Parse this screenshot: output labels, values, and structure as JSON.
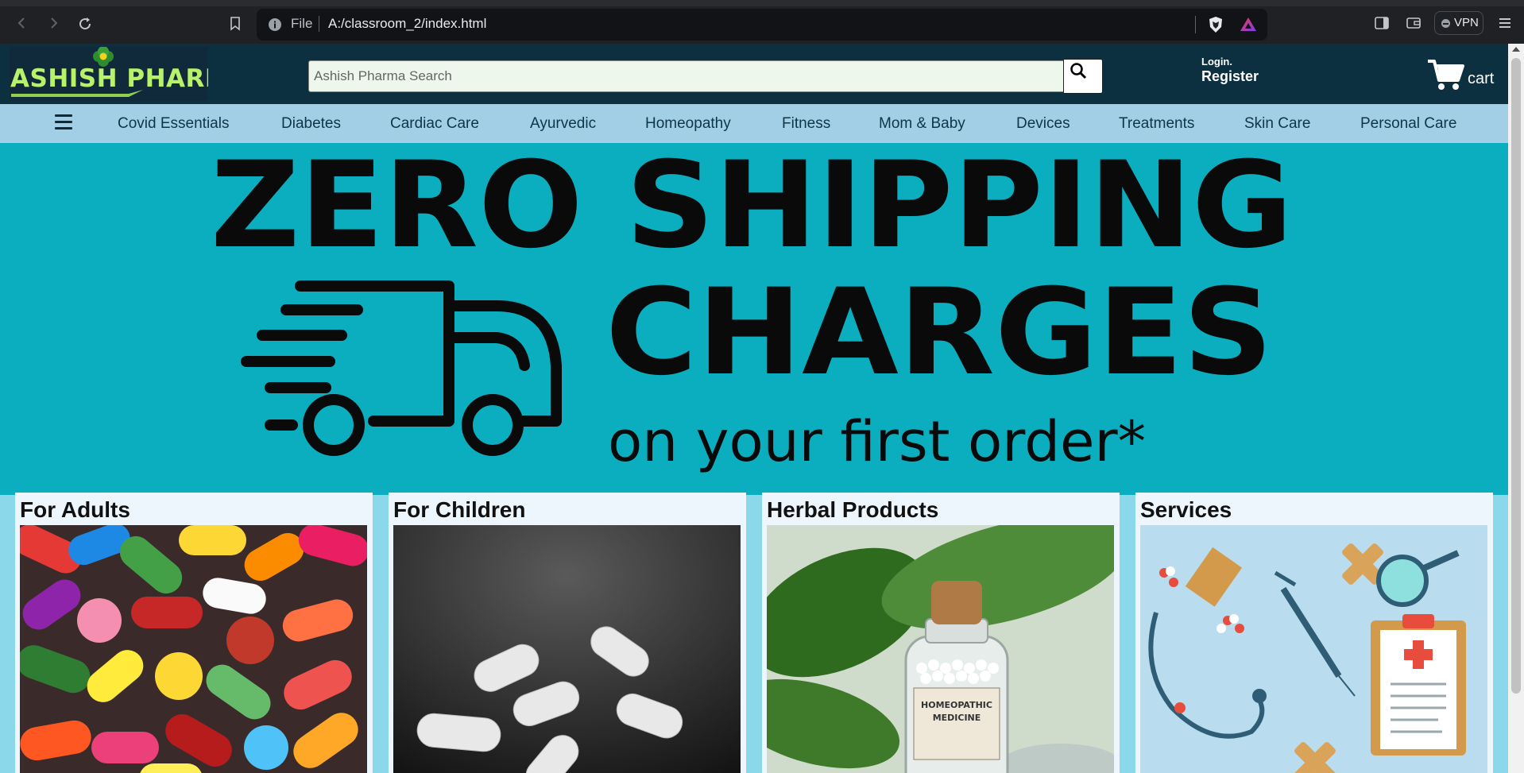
{
  "browser": {
    "url_scheme": "File",
    "url": "A:/classroom_2/index.html",
    "vpn_label": "VPN"
  },
  "header": {
    "logo_text": "ASHISH PHARMA",
    "search_placeholder": "Ashish Pharma Search",
    "login_label": "Login.",
    "register_label": "Register",
    "cart_label": "cart"
  },
  "nav": {
    "items": [
      {
        "label": "Covid Essentials"
      },
      {
        "label": "Diabetes"
      },
      {
        "label": "Cardiac Care"
      },
      {
        "label": "Ayurvedic"
      },
      {
        "label": "Homeopathy"
      },
      {
        "label": "Fitness"
      },
      {
        "label": "Mom & Baby"
      },
      {
        "label": "Devices"
      },
      {
        "label": "Treatments"
      },
      {
        "label": "Skin Care"
      },
      {
        "label": "Personal Care"
      }
    ]
  },
  "banner": {
    "line1": "ZERO SHIPPING",
    "line2": "CHARGES",
    "line3": "on your first order*"
  },
  "cards": [
    {
      "title": "For Adults"
    },
    {
      "title": "For Children"
    },
    {
      "title": "Herbal Products"
    },
    {
      "title": "Services"
    }
  ],
  "herbal_bottle_label": {
    "line1": "HOMEOPATHIC",
    "line2": "MEDICINE"
  },
  "colors": {
    "header_bg": "#0c3040",
    "nav_bg": "#a3cfe6",
    "banner_bg": "#0aaebf",
    "page_bg": "#8ad8ea",
    "logo_text": "#b8f16a"
  }
}
